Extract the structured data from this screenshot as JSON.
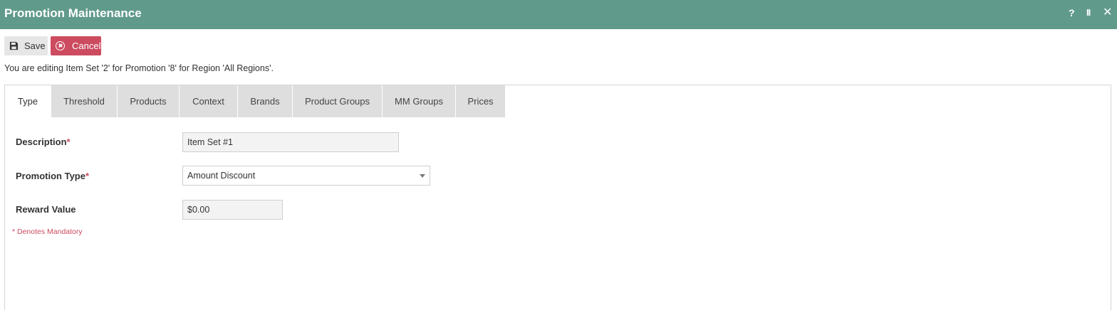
{
  "window": {
    "title": "Promotion Maintenance",
    "controls": {
      "help": "?",
      "pause": "II",
      "close": "✕"
    }
  },
  "toolbar": {
    "save_label": "Save",
    "cancel_label": "Cancel"
  },
  "info_text": "You are editing Item Set '2' for Promotion '8' for Region 'All Regions'.",
  "tabs": [
    {
      "label": "Type",
      "active": true
    },
    {
      "label": "Threshold",
      "active": false
    },
    {
      "label": "Products",
      "active": false
    },
    {
      "label": "Context",
      "active": false
    },
    {
      "label": "Brands",
      "active": false
    },
    {
      "label": "Product Groups",
      "active": false
    },
    {
      "label": "MM Groups",
      "active": false
    },
    {
      "label": "Prices",
      "active": false
    }
  ],
  "form": {
    "description": {
      "label": "Description",
      "required_mark": "*",
      "value": "Item Set #1"
    },
    "promotion_type": {
      "label": "Promotion Type",
      "required_mark": "*",
      "value": "Amount Discount"
    },
    "reward_value": {
      "label": "Reward Value",
      "value": "$0.00"
    },
    "mandatory_note": "* Denotes Mandatory"
  },
  "colors": {
    "titlebar": "#609a8b",
    "cancel": "#cc4b5f",
    "required": "#cc4b5f",
    "tab_inactive": "#dedede"
  }
}
